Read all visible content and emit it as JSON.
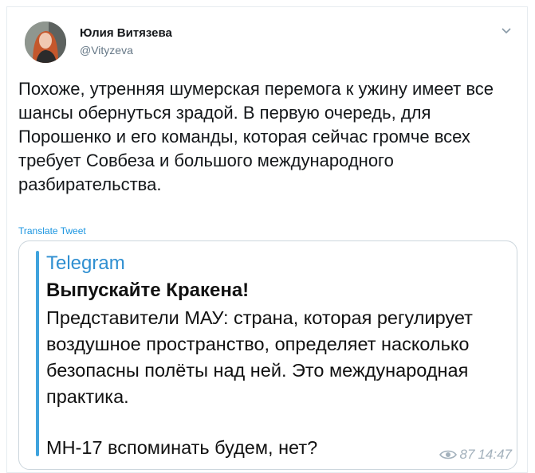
{
  "author": {
    "name": "Юлия Витязева",
    "handle": "@Vityzeva"
  },
  "tweet": {
    "text": "Похоже, утренняя шумерская перемога к ужину имеет все шансы обернуться зрадой. В первую очередь, для Порошенко и его команды, которая сейчас громче всех требует Совбеза и большого международного разбирательства.",
    "translate_label": "Translate Tweet"
  },
  "quote": {
    "source": "Telegram",
    "title": "Выпускайте Кракена!",
    "body": "Представители МАУ: страна, которая регулирует воздушное пространство, определяет насколько безопасны полёты над ней. Это международная практика.",
    "question": "МН-17 вспоминать будем, нет?",
    "views": "87",
    "time": "14:47"
  },
  "colors": {
    "accent": "#1b95e0",
    "telegram_blue": "#2f8fd1",
    "quote_bar": "#3fa3dd",
    "secondary_text": "#657786"
  }
}
